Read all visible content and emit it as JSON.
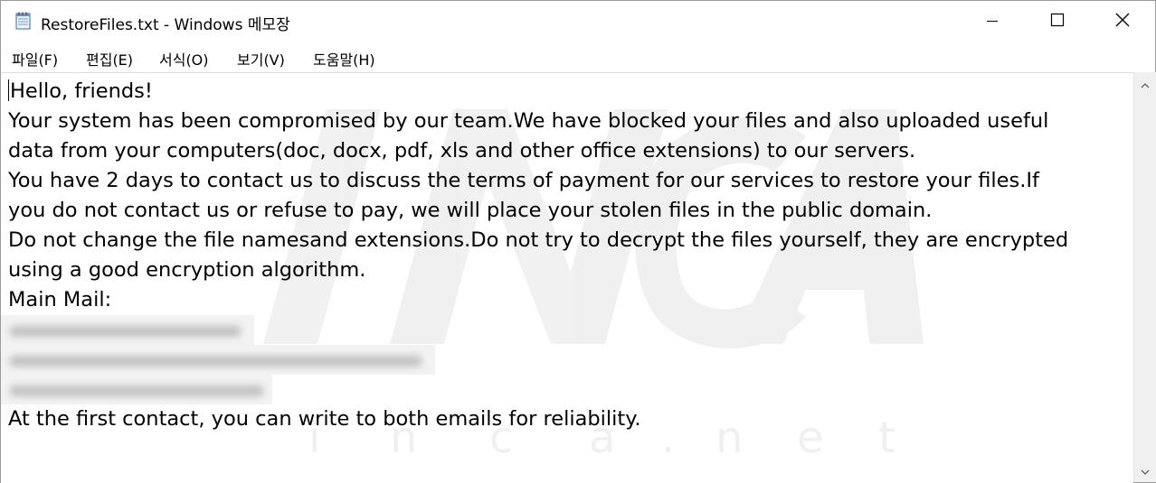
{
  "window": {
    "title": "RestoreFiles.txt - Windows 메모장"
  },
  "menu": {
    "items": [
      "파일(F)",
      "편집(E)",
      "서식(O)",
      "보기(V)",
      "도움말(H)"
    ]
  },
  "document": {
    "lines": [
      "Hello, friends!",
      "Your system has been compromised by our team.We have blocked your files and also uploaded useful",
      "data from your computers(doc, docx, pdf, xls and other office extensions) to our servers.",
      "You have 2 days to contact us to discuss the terms of payment for our services to restore your files.If",
      "you do not contact us or refuse to pay, we will place your stolen files in the public domain.",
      "Do not change the file namesand extensions.Do not try to decrypt the files yourself, they are encrypted",
      "using a good encryption algorithm.",
      "Main Mail:"
    ],
    "closing_line": "At the first contact, you can write to both emails for reliability."
  },
  "colors": {
    "text": "#000000",
    "background": "#ffffff",
    "watermark": "#e9e9e9"
  },
  "icons": {
    "app": "notepad-icon",
    "minimize": "minimize-icon",
    "maximize": "maximize-icon",
    "close": "close-icon",
    "scroll_up": "chevron-up-icon",
    "scroll_down": "chevron-down-icon"
  }
}
